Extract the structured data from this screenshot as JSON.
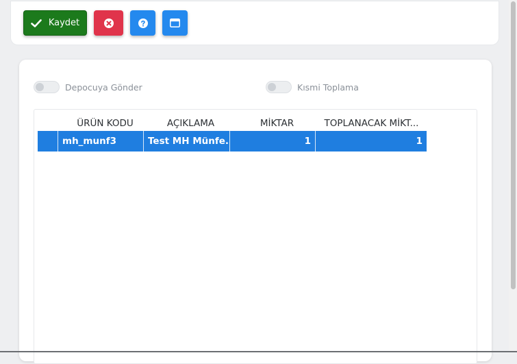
{
  "toolbar": {
    "save_label": "Kaydet",
    "colors": {
      "save": "#1c7a1c",
      "cancel": "#e0344b",
      "help": "#2489ee",
      "window": "#2489ee"
    },
    "icons": [
      "check-icon",
      "close-circle-icon",
      "help-circle-icon",
      "window-icon"
    ]
  },
  "toggles": {
    "depocuya_gonder": {
      "label": "Depocuya Gönder",
      "checked": false
    },
    "kismi_toplama": {
      "label": "Kısmi Toplama",
      "checked": false
    }
  },
  "grid": {
    "columns": [
      "ÜRÜN KODU",
      "AÇIKLAMA",
      "MİKTAR",
      "TOPLANACAK MİKT..."
    ],
    "rows": [
      {
        "urun_kodu": "mh_munf3",
        "aciklama": "Test MH Münfe...",
        "miktar": "1",
        "toplanacak": "1",
        "selected": true
      }
    ],
    "selected_row_color": "#1f7ee0"
  }
}
